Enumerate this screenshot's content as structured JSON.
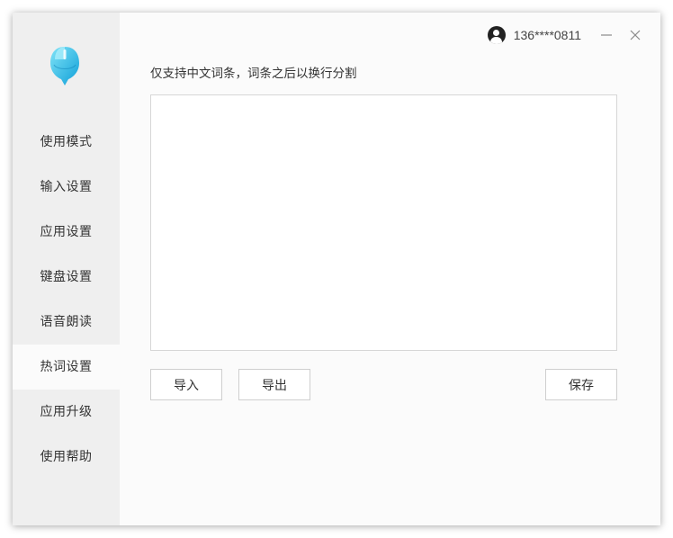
{
  "sidebar": {
    "logo_icon": "mouse-logo-icon",
    "items": [
      {
        "label": "使用模式",
        "active": false
      },
      {
        "label": "输入设置",
        "active": false
      },
      {
        "label": "应用设置",
        "active": false
      },
      {
        "label": "键盘设置",
        "active": false
      },
      {
        "label": "语音朗读",
        "active": false
      },
      {
        "label": "热词设置",
        "active": true
      },
      {
        "label": "应用升级",
        "active": false
      },
      {
        "label": "使用帮助",
        "active": false
      }
    ]
  },
  "header": {
    "user_icon": "user-avatar-icon",
    "phone": "136****0811",
    "minimize_icon": "minimize-icon",
    "close_icon": "close-icon"
  },
  "hotwords": {
    "hint": "仅支持中文词条，词条之后以换行分割",
    "value": "",
    "placeholder": ""
  },
  "buttons": {
    "import": "导入",
    "export": "导出",
    "save": "保存"
  },
  "colors": {
    "sidebar_bg": "#efefef",
    "content_bg": "#fbfbfb",
    "logo_blue": "#29b8e6",
    "text": "#333333"
  }
}
